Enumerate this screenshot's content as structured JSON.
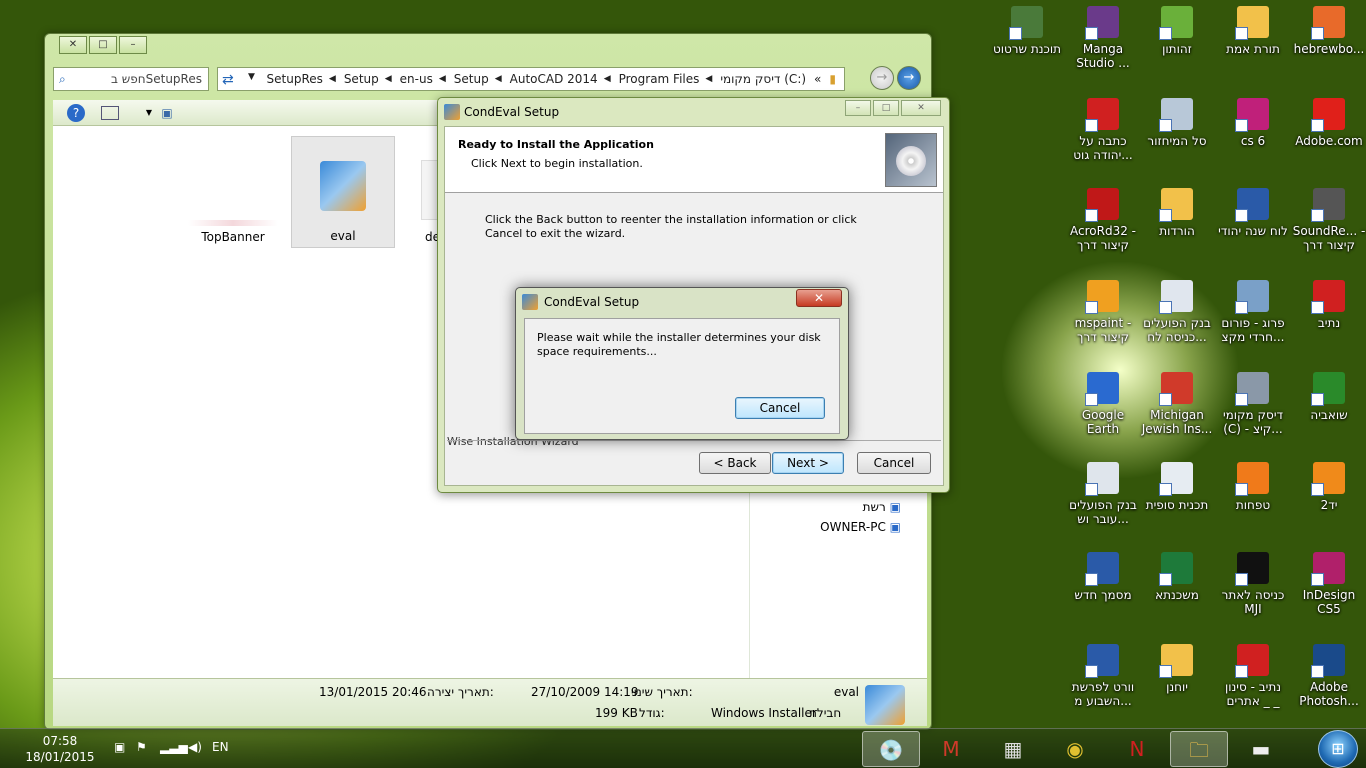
{
  "explorer": {
    "address_segments": [
      "SetupRes",
      "Setup",
      "en-us",
      "Setup",
      "AutoCAD 2014",
      "Program Files",
      "דיסק מקומי (C:)"
    ],
    "address_more": "«",
    "search_placeholder": "חפש בSetupRes",
    "files": [
      {
        "name": "TopBanner"
      },
      {
        "name": "eval"
      },
      {
        "name": "de"
      }
    ],
    "nav_items": [
      {
        "label": "רשת"
      },
      {
        "label": "OWNER-PC"
      }
    ],
    "details": {
      "name": "eval",
      "type_label": "חבילת",
      "type_value": "Windows Installer",
      "modified_label": "תאריך שינוי:",
      "modified_value": "27/10/2009 14:19",
      "created_label": "תאריך יצירה:",
      "created_value": "13/01/2015 20:46",
      "size_label": "גודל:",
      "size_value": "199 KB"
    }
  },
  "wizard": {
    "title": "CondEval Setup",
    "heading": "Ready to Install the Application",
    "subheading": "Click Next to begin installation.",
    "message": "Click the Back button to reenter the installation information or click Cancel to exit the wizard.",
    "footer": "Wise Installation Wizard",
    "back_label": "< Back",
    "next_label": "Next >",
    "cancel_label": "Cancel"
  },
  "progress_dialog": {
    "title": "CondEval Setup",
    "message": "Please wait while the installer determines your disk space requirements...",
    "cancel_label": "Cancel",
    "close_glyph": "✕"
  },
  "desktop_icons": [
    {
      "label": "hebrewbo...",
      "icon": "book-icon",
      "color": "#e86a2a"
    },
    {
      "label": "תורת אמת",
      "icon": "folder-icon",
      "color": "#f2c14a"
    },
    {
      "label": "זהותון",
      "icon": "app-icon",
      "color": "#6ab03a"
    },
    {
      "label": "Manga Studio ...",
      "icon": "manga-icon",
      "color": "#6a3a8a"
    },
    {
      "label": "תוכנת שרטוט",
      "icon": "tool-icon",
      "color": "#4a7a3a"
    },
    {
      "label": "Adobe.com",
      "icon": "adobe-icon",
      "color": "#e0201a"
    },
    {
      "label": "cs 6",
      "icon": "indesign-icon",
      "color": "#c0207a"
    },
    {
      "label": "סל המיחזור",
      "icon": "recycle-bin-icon",
      "color": "#b8c8d8"
    },
    {
      "label": "כתבה על יהודה גוט...",
      "icon": "pdf-icon",
      "color": "#d02020"
    },
    {
      "label": "SoundRe... - קיצור דרך",
      "icon": "microphone-icon",
      "color": "#555555"
    },
    {
      "label": "לוח שנה יהודי",
      "icon": "calendar-icon",
      "color": "#2a5aa8"
    },
    {
      "label": "הורדות",
      "icon": "downloads-folder-icon",
      "color": "#f2c14a"
    },
    {
      "label": "AcroRd32 - קיצור דרך",
      "icon": "acrobat-icon",
      "color": "#c01818"
    },
    {
      "label": "נתיב",
      "icon": "nativ-icon",
      "color": "#d02020"
    },
    {
      "label": "פרוג - פורום חרדי מקצ...",
      "icon": "shortcut-icon",
      "color": "#7aa0c8"
    },
    {
      "label": "בנק הפועלים כניסה לח...",
      "icon": "document-icon",
      "color": "#e0e6ee"
    },
    {
      "label": "mspaint - קיצור דרך",
      "icon": "paint-icon",
      "color": "#f0a020"
    },
    {
      "label": "שואביה",
      "icon": "tree-icon",
      "color": "#2a8a2a"
    },
    {
      "label": "דיסק מקומי (C) - קיצ...",
      "icon": "drive-icon",
      "color": "#8a98a8"
    },
    {
      "label": "Michigan Jewish Ins...",
      "icon": "gmail-icon",
      "color": "#d03a2a"
    },
    {
      "label": "Google Earth",
      "icon": "google-earth-icon",
      "color": "#2a6ad0"
    },
    {
      "label": "יד2",
      "icon": "yad2-icon",
      "color": "#f08a1a"
    },
    {
      "label": "טפחות",
      "icon": "tefahot-icon",
      "color": "#f07a1a"
    },
    {
      "label": "תכנית סופית",
      "icon": "document-icon",
      "color": "#e6ecf2"
    },
    {
      "label": "בנק הפועלים עובר וש...",
      "icon": "document-icon",
      "color": "#dfe5ec"
    },
    {
      "label": "InDesign CS5",
      "icon": "indesign-icon",
      "color": "#b0206a"
    },
    {
      "label": "כניסה לאתר MJI",
      "icon": "black-square-icon",
      "color": "#111111"
    },
    {
      "label": "משכנתא",
      "icon": "excel-icon",
      "color": "#1e7a3a"
    },
    {
      "label": "מסמך חדש",
      "icon": "word-icon",
      "color": "#2a5aa8"
    },
    {
      "label": "Adobe Photosh...",
      "icon": "photoshop-icon",
      "color": "#1a4a8a"
    },
    {
      "label": "נתיב - סינון אתרים _ _",
      "icon": "nativ-icon",
      "color": "#d02020"
    },
    {
      "label": "יוחנן",
      "icon": "folder-icon",
      "color": "#f2c14a"
    },
    {
      "label": "וורט לפרשת השבוע מ...",
      "icon": "word-icon",
      "color": "#2a5aa8"
    }
  ],
  "taskbar": {
    "time": "07:58",
    "date": "18/01/2015",
    "lang": "EN",
    "apps": [
      {
        "icon": "installer-icon",
        "glyph": "💿"
      },
      {
        "icon": "gmail-icon",
        "glyph": "M"
      },
      {
        "icon": "calculator-icon",
        "glyph": "▦"
      },
      {
        "icon": "chrome-icon",
        "glyph": "◉"
      },
      {
        "icon": "nativ-icon",
        "glyph": "N"
      },
      {
        "icon": "explorer-folder-icon",
        "glyph": "🗀"
      },
      {
        "icon": "scanner-icon",
        "glyph": "▬"
      }
    ]
  }
}
